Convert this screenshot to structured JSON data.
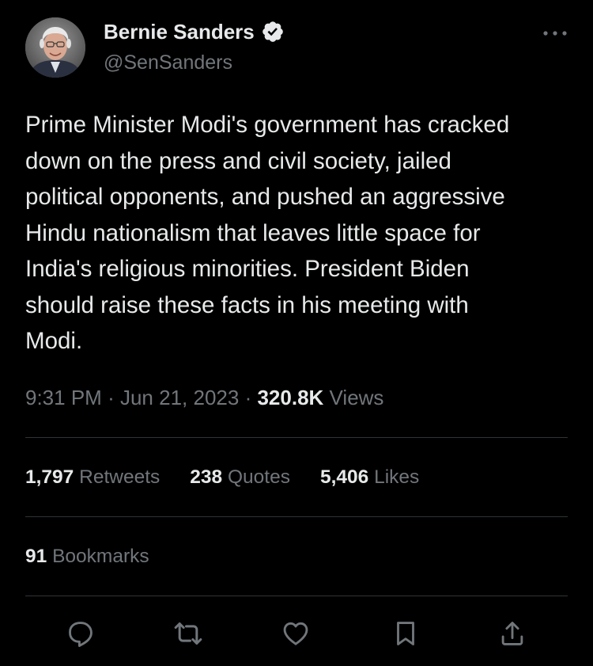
{
  "author": {
    "display_name": "Bernie Sanders",
    "handle": "@SenSanders",
    "verified": true
  },
  "tweet": {
    "text": "Prime Minister Modi's government has cracked\ndown on the press and civil society, jailed\npolitical opponents, and pushed an aggressive\nHindu nationalism that leaves little space for\nIndia's religious minorities. President Biden\nshould raise these facts in his meeting with\nModi.",
    "time": "9:31 PM",
    "date": "Jun 21, 2023",
    "separator": "·",
    "views_count": "320.8K",
    "views_label": "Views"
  },
  "stats": {
    "retweets_count": "1,797",
    "retweets_label": "Retweets",
    "quotes_count": "238",
    "quotes_label": "Quotes",
    "likes_count": "5,406",
    "likes_label": "Likes",
    "bookmarks_count": "91",
    "bookmarks_label": "Bookmarks"
  },
  "icons": {
    "more": "more-horizontal-icon",
    "verified": "verified-badge-icon",
    "reply": "reply-icon",
    "retweet": "retweet-icon",
    "like": "heart-icon",
    "bookmark": "bookmark-icon",
    "share": "share-icon"
  },
  "colors": {
    "background": "#000000",
    "text_primary": "#e7e9ea",
    "text_secondary": "#71767b",
    "divider": "#2f3336"
  }
}
